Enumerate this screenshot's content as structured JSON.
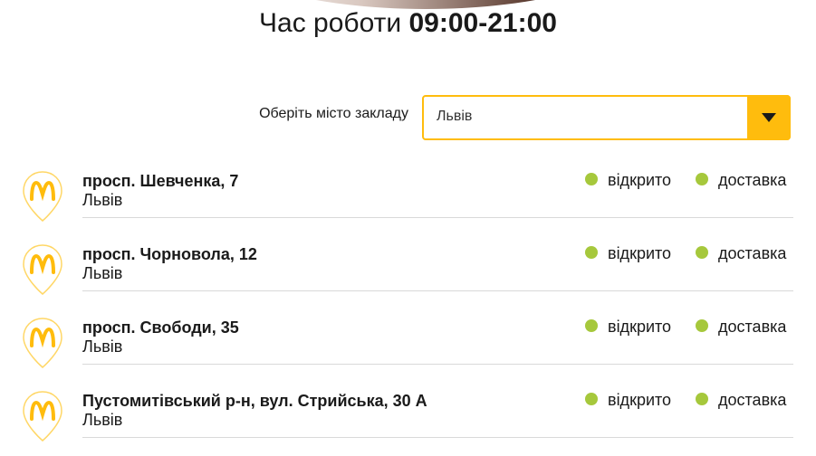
{
  "header": {
    "hours_label": "Час роботи",
    "hours_value": "09:00-21:00"
  },
  "city_picker": {
    "label": "Оберіть місто закладу",
    "selected": "Львів"
  },
  "colors": {
    "brand_yellow": "#ffbc0d",
    "status_green": "#a6c83c"
  },
  "restaurants": [
    {
      "address": "просп. Шевченка, 7",
      "city": "Львів",
      "status_open": "відкрито",
      "status_delivery": "доставка"
    },
    {
      "address": "просп. Чорновола, 12",
      "city": "Львів",
      "status_open": "відкрито",
      "status_delivery": "доставка"
    },
    {
      "address": "просп. Свободи, 35",
      "city": "Львів",
      "status_open": "відкрито",
      "status_delivery": "доставка"
    },
    {
      "address": "Пустомитівський р-н, вул. Стрийська, 30 А",
      "city": "Львів",
      "status_open": "відкрито",
      "status_delivery": "доставка"
    }
  ]
}
